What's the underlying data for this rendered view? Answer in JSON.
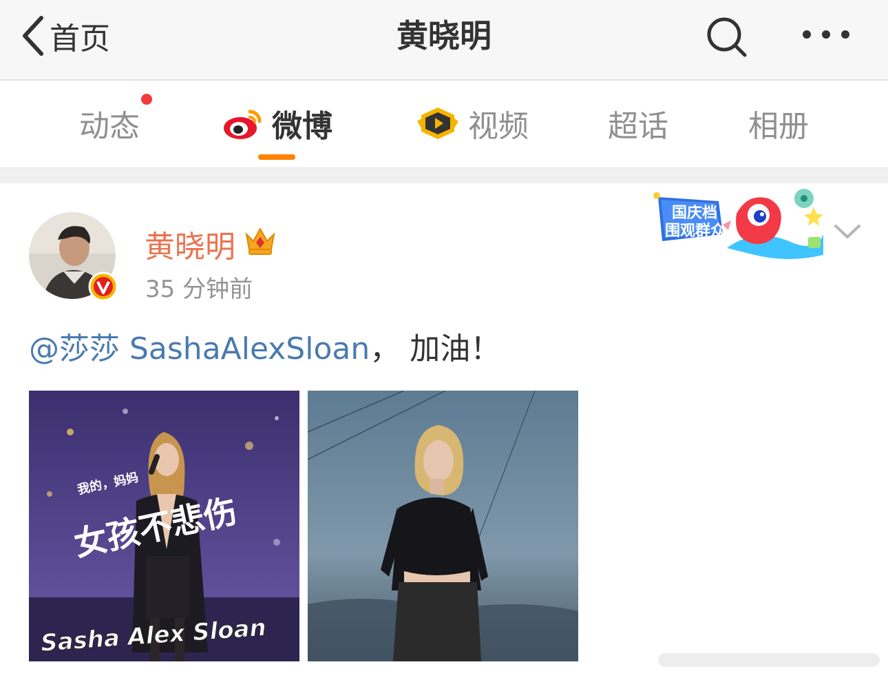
{
  "navbar": {
    "back_label": "首页",
    "title": "黄晓明"
  },
  "tabs": [
    {
      "label": "动态",
      "has_dot": true
    },
    {
      "label": "微博",
      "active": true
    },
    {
      "label": "视频"
    },
    {
      "label": "超话"
    },
    {
      "label": "相册"
    }
  ],
  "post": {
    "author": "黄晓明",
    "time": "35 分钟前",
    "mention": "@莎莎 SashaAlexSloan",
    "text_rest": "， 加油！",
    "campaign_badge": {
      "line1": "国庆档",
      "line2": "围观群众"
    },
    "images": [
      {
        "overlay_text": "女孩不悲伤",
        "caption": "Sasha Alex Sloan",
        "small_text": "我的，妈妈"
      },
      {}
    ]
  },
  "colors": {
    "accent": "#ff8200",
    "author_name": "#eb7350",
    "mention": "#4a7ab0",
    "notify_dot": "#f5393d"
  },
  "icons": [
    "back-arrow-icon",
    "search-icon",
    "more-icon",
    "weibo-logo-icon",
    "video-play-icon",
    "crown-icon",
    "verified-v-icon",
    "chevron-down-icon"
  ]
}
